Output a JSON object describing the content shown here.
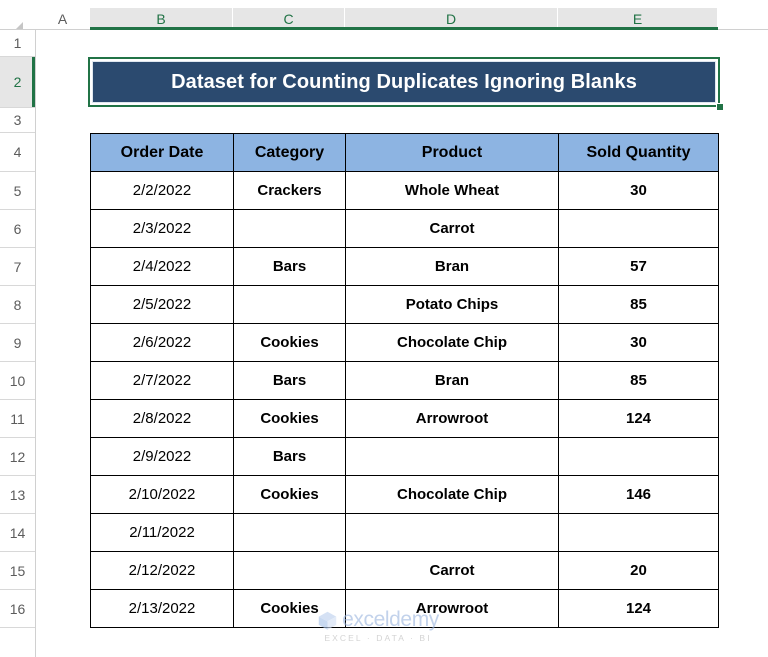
{
  "app": {
    "type": "spreadsheet",
    "accent_green": "#217346",
    "title_fill": "#2b4a6f",
    "header_fill": "#8db4e2",
    "grid_line": "#000000"
  },
  "column_headers": [
    {
      "label": "A",
      "selected": false
    },
    {
      "label": "B",
      "selected": true
    },
    {
      "label": "C",
      "selected": true
    },
    {
      "label": "D",
      "selected": true
    },
    {
      "label": "E",
      "selected": true
    }
  ],
  "row_headers": [
    {
      "label": "1",
      "selected": false
    },
    {
      "label": "2",
      "selected": true
    },
    {
      "label": "3",
      "selected": false
    },
    {
      "label": "4",
      "selected": false
    },
    {
      "label": "5",
      "selected": false
    },
    {
      "label": "6",
      "selected": false
    },
    {
      "label": "7",
      "selected": false
    },
    {
      "label": "8",
      "selected": false
    },
    {
      "label": "9",
      "selected": false
    },
    {
      "label": "10",
      "selected": false
    },
    {
      "label": "11",
      "selected": false
    },
    {
      "label": "12",
      "selected": false
    },
    {
      "label": "13",
      "selected": false
    },
    {
      "label": "14",
      "selected": false
    },
    {
      "label": "15",
      "selected": false
    },
    {
      "label": "16",
      "selected": false
    }
  ],
  "title": {
    "text": "Dataset for Counting Duplicates Ignoring Blanks"
  },
  "table": {
    "headers": [
      "Order Date",
      "Category",
      "Product",
      "Sold Quantity"
    ],
    "rows": [
      {
        "order_date": "2/2/2022",
        "category": "Crackers",
        "product": "Whole Wheat",
        "sold_quantity": "30"
      },
      {
        "order_date": "2/3/2022",
        "category": "",
        "product": "Carrot",
        "sold_quantity": ""
      },
      {
        "order_date": "2/4/2022",
        "category": "Bars",
        "product": "Bran",
        "sold_quantity": "57"
      },
      {
        "order_date": "2/5/2022",
        "category": "",
        "product": "Potato Chips",
        "sold_quantity": "85"
      },
      {
        "order_date": "2/6/2022",
        "category": "Cookies",
        "product": "Chocolate Chip",
        "sold_quantity": "30"
      },
      {
        "order_date": "2/7/2022",
        "category": "Bars",
        "product": "Bran",
        "sold_quantity": "85"
      },
      {
        "order_date": "2/8/2022",
        "category": "Cookies",
        "product": "Arrowroot",
        "sold_quantity": "124"
      },
      {
        "order_date": "2/9/2022",
        "category": "Bars",
        "product": "",
        "sold_quantity": ""
      },
      {
        "order_date": "2/10/2022",
        "category": "Cookies",
        "product": "Chocolate Chip",
        "sold_quantity": "146"
      },
      {
        "order_date": "2/11/2022",
        "category": "",
        "product": "",
        "sold_quantity": ""
      },
      {
        "order_date": "2/12/2022",
        "category": "",
        "product": "Carrot",
        "sold_quantity": "20"
      },
      {
        "order_date": "2/13/2022",
        "category": "Cookies",
        "product": "Arrowroot",
        "sold_quantity": "124"
      }
    ]
  },
  "watermark": {
    "brand": "exceldemy",
    "tagline": "EXCEL · DATA · BI"
  }
}
